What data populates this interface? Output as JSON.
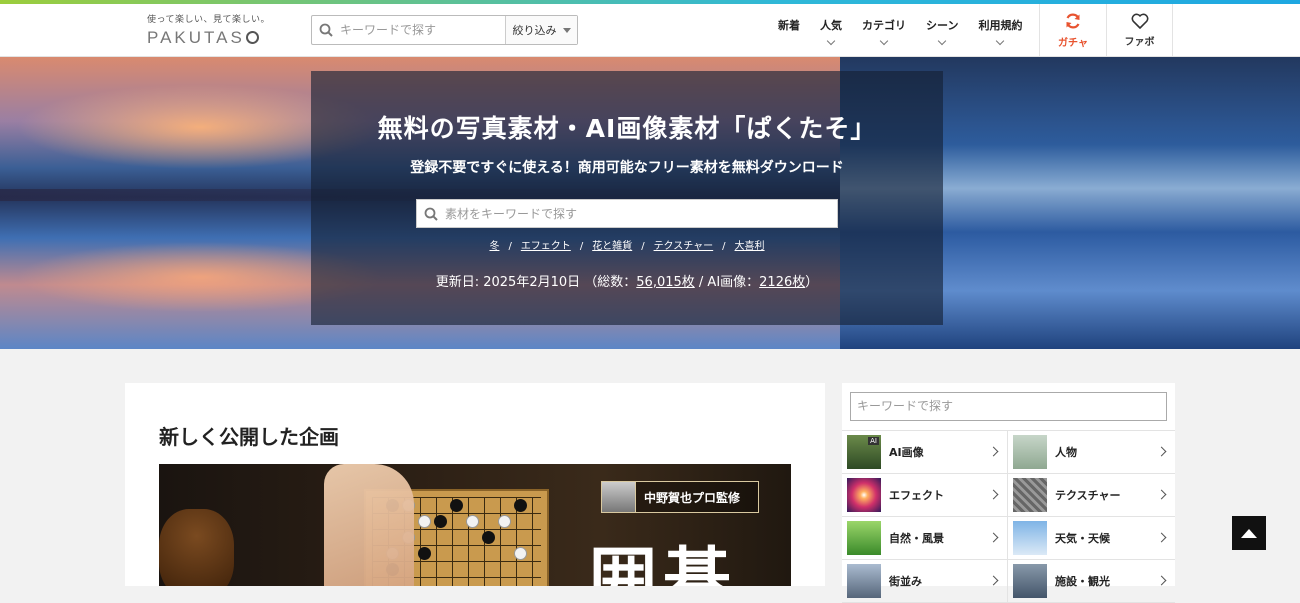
{
  "header": {
    "logo_tagline": "使って楽しい、見て楽しい。",
    "logo_text": "PAKUTAS",
    "search_placeholder": "キーワードで探す",
    "filter_label": "絞り込み",
    "nav": [
      {
        "label": "新着",
        "has_dropdown": false
      },
      {
        "label": "人気",
        "has_dropdown": true
      },
      {
        "label": "カテゴリ",
        "has_dropdown": true
      },
      {
        "label": "シーン",
        "has_dropdown": true
      },
      {
        "label": "利用規約",
        "has_dropdown": true
      }
    ],
    "gacha_label": "ガチャ",
    "fav_label": "ファボ"
  },
  "hero": {
    "title": "無料の写真素材・AI画像素材「ぱくたそ」",
    "subtitle": "登録不要ですぐに使える！商用可能なフリー素材を無料ダウンロード",
    "search_placeholder": "素材をキーワードで探す",
    "tags": [
      "冬",
      "エフェクト",
      "花と雑貨",
      "テクスチャー",
      "大喜利"
    ],
    "updated_prefix": "更新日: 2025年2月10日 （総数：",
    "total_count": "56,015枚",
    "ai_prefix": " / AI画像：",
    "ai_count": "2126枚",
    "updated_suffix": "）"
  },
  "content": {
    "section_title": "新しく公開した企画",
    "banner_supervisor": "中野賀也プロ監修",
    "banner_kanji": "囲碁"
  },
  "sidebar": {
    "search_placeholder": "キーワードで探す",
    "categories": [
      {
        "label": "AI画像",
        "icon": "ai-thumb"
      },
      {
        "label": "人物",
        "icon": "person-thumb"
      },
      {
        "label": "エフェクト",
        "icon": "effect-thumb"
      },
      {
        "label": "テクスチャー",
        "icon": "texture-thumb"
      },
      {
        "label": "自然・風景",
        "icon": "nature-thumb"
      },
      {
        "label": "天気・天候",
        "icon": "weather-thumb"
      },
      {
        "label": "街並み",
        "icon": "town-thumb"
      },
      {
        "label": "施設・観光",
        "icon": "facility-thumb"
      }
    ]
  },
  "colors": {
    "accent_gacha": "#e8532f",
    "top_line_start": "#9ccd3c",
    "top_line_end": "#1ea7e1"
  }
}
